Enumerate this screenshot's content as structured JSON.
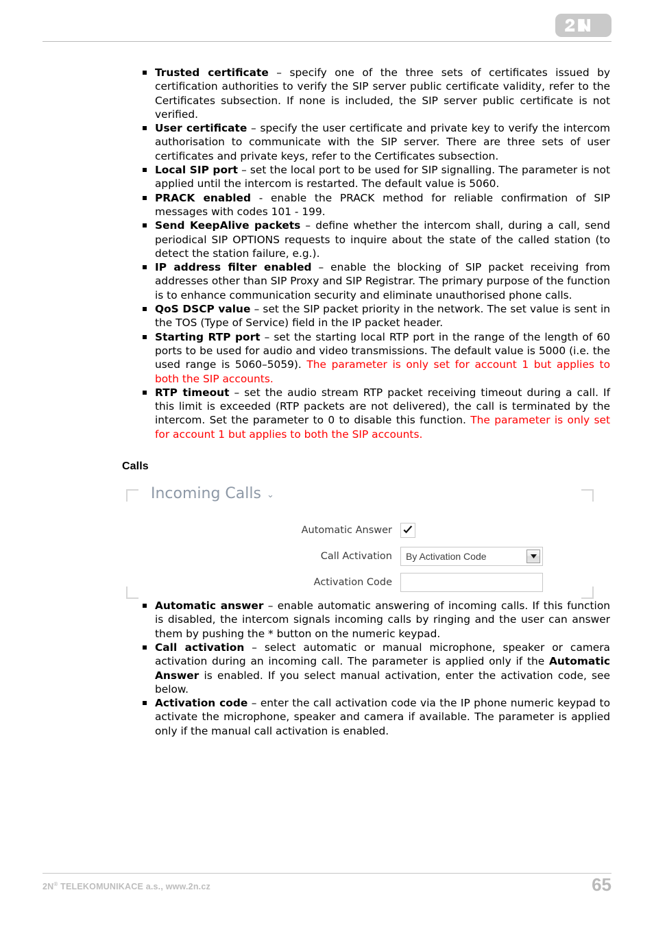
{
  "header": {
    "logo_text": "2N"
  },
  "sip_bullets": [
    {
      "term": "Trusted certificate",
      "segments": [
        {
          "text": " – specify one of the three sets of certificates issued by certification authorities to verify the SIP server public certificate validity, refer to the Certificates subsection. If none is included, the SIP server public certificate is not verified.",
          "color": "black"
        }
      ]
    },
    {
      "term": "User certificate",
      "segments": [
        {
          "text": " – specify the user certificate and private key to verify the intercom authorisation to communicate with the SIP server. There are three sets of user certificates and private keys, refer to the Certificates subsection.",
          "color": "black"
        }
      ]
    },
    {
      "term": "Local SIP port",
      "segments": [
        {
          "text": " – set the local port to be used for SIP signalling. The parameter is not applied until the intercom is restarted. The default value is 5060.",
          "color": "black"
        }
      ]
    },
    {
      "term": "PRACK enabled",
      "segments": [
        {
          "text": " - enable the PRACK method for reliable confirmation of SIP messages with codes 101 - 199.",
          "color": "black"
        }
      ]
    },
    {
      "term": "Send KeepAlive packets",
      "segments": [
        {
          "text": " – define whether the intercom shall, during a call, send periodical SIP OPTIONS requests to inquire about the state of the called station (to detect the station failure, e.g.).",
          "color": "black"
        }
      ]
    },
    {
      "term": "IP address filter enabled",
      "segments": [
        {
          "text": " – enable the blocking of SIP packet receiving from addresses other than SIP Proxy and SIP Registrar. The primary purpose of the function is to enhance communication security and eliminate unauthorised phone calls.",
          "color": "black"
        }
      ]
    },
    {
      "term": "QoS DSCP value",
      "segments": [
        {
          "text": " – set the SIP packet priority in the network. The set value is sent in the TOS (Type of Service) field in the IP packet header.",
          "color": "black"
        }
      ]
    },
    {
      "term": "Starting RTP port",
      "segments": [
        {
          "text": " – set the starting local RTP port in the range of the length of 60 ports to be used for audio and video transmissions. The default value is 5000 (i.e. the used range is 5060–5059). ",
          "color": "black"
        },
        {
          "text": "The parameter is only set for account 1 but applies to both the SIP accounts.",
          "color": "red"
        }
      ]
    },
    {
      "term": "RTP timeout",
      "segments": [
        {
          "text": " – set the audio stream RTP packet receiving timeout during a call. If this limit is exceeded (RTP packets are not delivered), the call is terminated by the intercom. Set the parameter to 0 to disable this function. ",
          "color": "black"
        },
        {
          "text": "The parameter is only set for account 1 but applies to both the SIP accounts.",
          "color": "red"
        }
      ]
    }
  ],
  "section": {
    "heading": "Calls"
  },
  "panel": {
    "title": "Incoming Calls",
    "chevron": "⌄",
    "rows": [
      {
        "label": "Automatic Answer",
        "type": "checkbox",
        "checked": true
      },
      {
        "label": "Call Activation",
        "type": "select",
        "value": "By Activation Code"
      },
      {
        "label": "Activation Code",
        "type": "text",
        "value": ""
      }
    ]
  },
  "calls_bullets": [
    {
      "term": "Automatic answer",
      "segments": [
        {
          "text": " – enable automatic answering of incoming calls. If this function is disabled, the intercom signals incoming calls by ringing and the user can answer them by pushing the * button on the numeric keypad.",
          "color": "black"
        }
      ]
    },
    {
      "term": "Call activation",
      "segments": [
        {
          "text": " – select automatic or manual microphone, speaker or camera activation during an incoming call. The parameter is applied only if the ",
          "color": "black"
        },
        {
          "text": "Automatic Answer",
          "color": "black",
          "bold": true
        },
        {
          "text": " is enabled. If you select manual activation, enter the activation code, see below.",
          "color": "black"
        }
      ]
    },
    {
      "term": "Activation code",
      "segments": [
        {
          "text": " – enter the call activation code via the IP phone numeric keypad to activate the microphone, speaker and camera if available. The parameter is applied only if the manual call activation is enabled.",
          "color": "black"
        }
      ]
    }
  ],
  "footer": {
    "company_prefix": "2N",
    "registered_mark": "®",
    "company_suffix": " TELEKOMUNIKACE a.s., www.2n.cz",
    "page_number": "65"
  }
}
